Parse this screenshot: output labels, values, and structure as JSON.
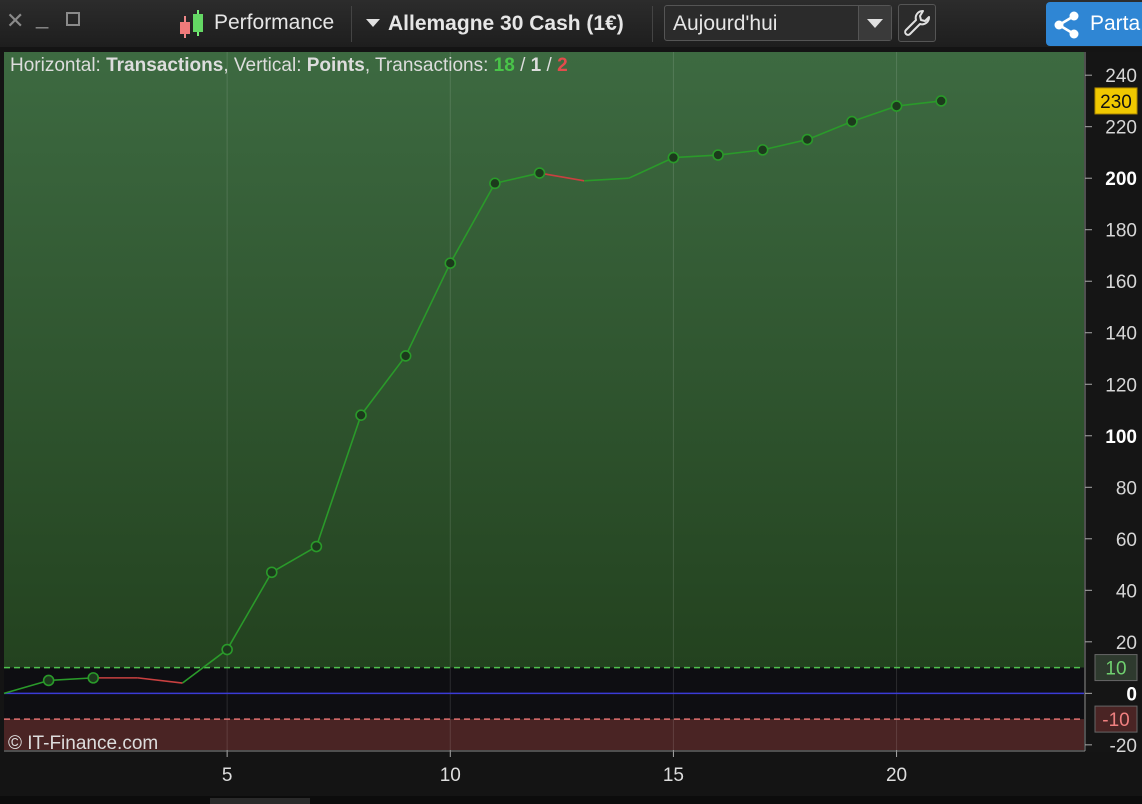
{
  "window": {
    "close_icon": "close-icon",
    "minimize_icon": "minimize-icon",
    "maximize_icon": "maximize-icon"
  },
  "toolbar": {
    "performance_label": "Performance",
    "instrument_label": "Allemagne 30 Cash (1€)",
    "period_label": "Aujourd'hui",
    "share_label": "Parta",
    "share_color": "#2f86d4"
  },
  "header": {
    "horizontal_label": "Horizontal: ",
    "horizontal_value": "Transactions",
    "vertical_label": ", Vertical: ",
    "vertical_value": "Points",
    "transactions_label": ", Transactions: ",
    "wins": "18",
    "neutral": "1",
    "losses": "2",
    "sep": " / "
  },
  "copyright": "© IT-Finance.com",
  "chart_data": {
    "type": "line",
    "x": [
      0,
      1,
      2,
      3,
      4,
      5,
      6,
      7,
      8,
      9,
      10,
      11,
      12,
      13,
      14,
      15,
      16,
      17,
      18,
      19,
      20,
      21
    ],
    "y": [
      0,
      5,
      6,
      6,
      4,
      17,
      47,
      57,
      108,
      131,
      167,
      198,
      202,
      199,
      200,
      208,
      209,
      211,
      215,
      222,
      228,
      230
    ],
    "markers": [
      1,
      2,
      5,
      6,
      7,
      8,
      9,
      10,
      11,
      12,
      15,
      16,
      17,
      18,
      19,
      20,
      21
    ],
    "losing_segments": [
      [
        2,
        4
      ],
      [
        12,
        13
      ]
    ],
    "xlim": [
      0,
      24.2
    ],
    "ylim": [
      -22,
      249
    ],
    "x_ticks": [
      5,
      10,
      15,
      20
    ],
    "y_ticks": [
      240,
      220,
      200,
      180,
      160,
      140,
      120,
      100,
      80,
      60,
      40,
      20,
      0,
      -20
    ],
    "y_bold_ticks": [
      200,
      100,
      0
    ],
    "current_value": 230,
    "upper_threshold": 10,
    "lower_threshold": -10,
    "colors": {
      "line": "#2a9a2a",
      "loss": "#c94040",
      "marker_fill": "#1c3a1c",
      "upper": "#4ec24e",
      "lower": "#e07070",
      "zero": "#3b3bd6",
      "current_badge": "#f0c800"
    }
  }
}
